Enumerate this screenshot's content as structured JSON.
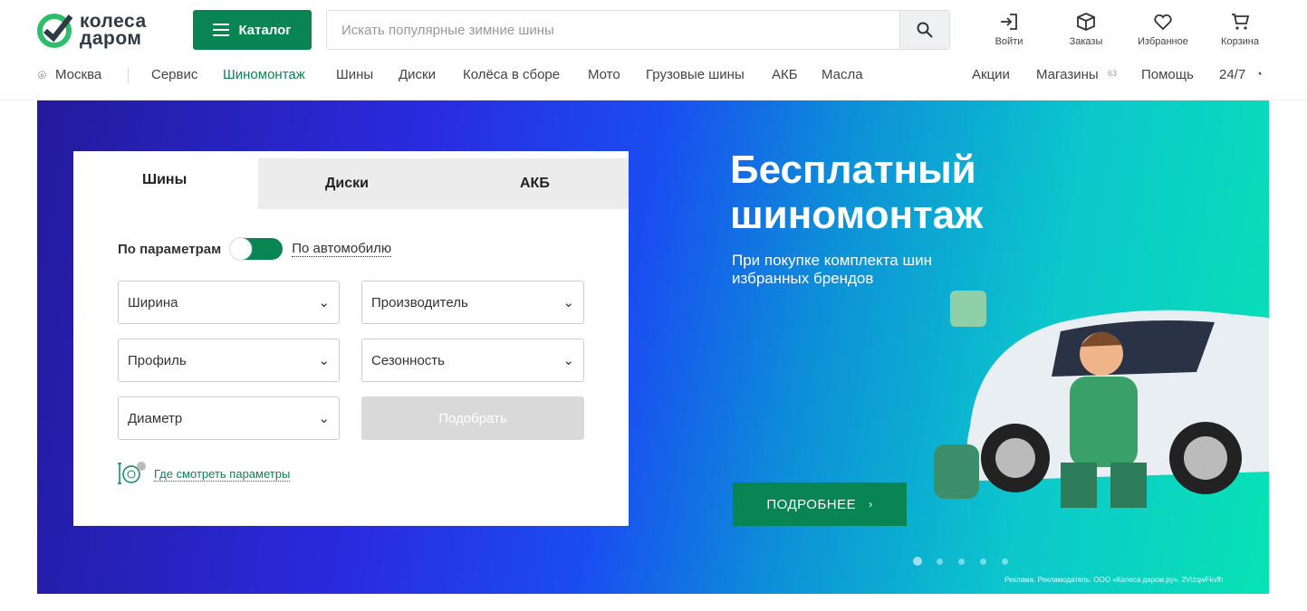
{
  "header": {
    "logo_line1": "колеса",
    "logo_line2": "даром",
    "catalog_label": "Каталог",
    "search_placeholder": "Искать популярные зимние шины",
    "actions": [
      {
        "label": "Войти",
        "icon": "login-icon"
      },
      {
        "label": "Заказы",
        "icon": "box-icon"
      },
      {
        "label": "Избранное",
        "icon": "heart-icon"
      },
      {
        "label": "Корзина",
        "icon": "cart-icon"
      }
    ]
  },
  "nav": {
    "city": "Москва",
    "items": [
      "Сервис",
      "Шиномонтаж",
      "Шины",
      "Диски",
      "Колёса в сборе",
      "Мото",
      "Грузовые шины",
      "АКБ",
      "Масла"
    ],
    "right": [
      "Акции",
      "Магазины",
      "Помощь",
      "24/7"
    ],
    "shops_count": "63"
  },
  "search_panel": {
    "tabs": [
      "Шины",
      "Диски",
      "АКБ"
    ],
    "mode_label": "По параметрам",
    "alt_mode": "По автомобилю",
    "fields": [
      "Ширина",
      "Производитель",
      "Профиль",
      "Сезонность",
      "Диаметр"
    ],
    "submit": "Подобрать",
    "help_link": "Где смотреть параметры"
  },
  "banner": {
    "title_line1": "Бесплатный",
    "title_line2": "шиномонтаж",
    "subtitle_line1": "При покупке комплекта шин",
    "subtitle_line2": "избранных брендов",
    "button": "ПОДРОБНЕЕ",
    "slides": 5,
    "active_slide": 1,
    "ad_note": "Реклама. Рекламодатель: ООО «Колеса даром.ру», 2VtzqwFkvfh"
  },
  "colors": {
    "brand": "#088553"
  }
}
